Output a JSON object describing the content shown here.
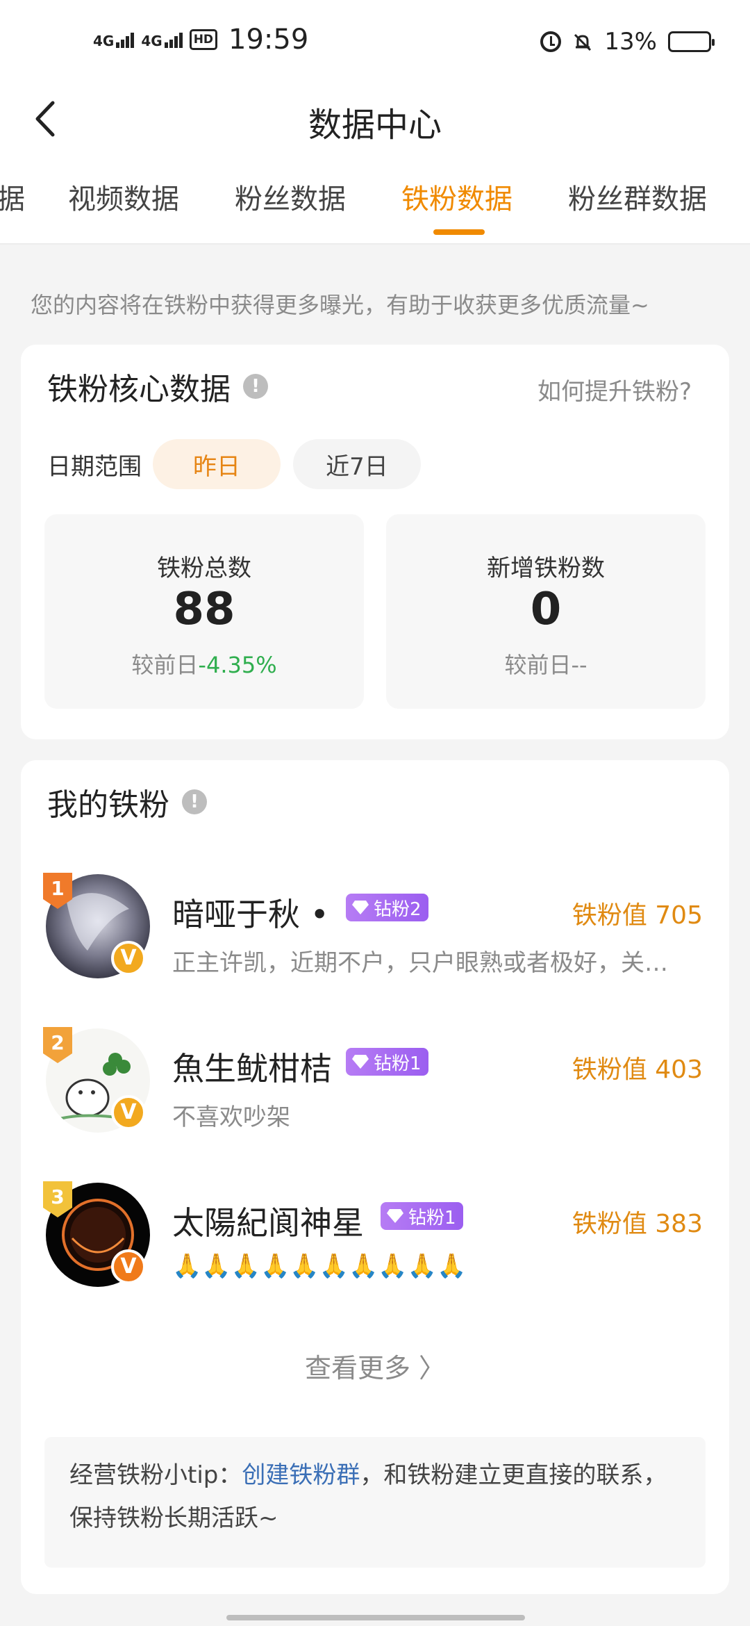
{
  "status_bar": {
    "network1": "4G",
    "network2": "4G",
    "hd": "HD",
    "time": "19:59",
    "battery_text": "13%",
    "battery_level": 0.13,
    "icons": [
      "alarm-icon",
      "bell-off-icon",
      "battery-icon"
    ]
  },
  "nav": {
    "title": "数据中心",
    "back_icon": "chevron-left-icon"
  },
  "tabs": [
    {
      "label": "据"
    },
    {
      "label": "视频数据"
    },
    {
      "label": "粉丝数据"
    },
    {
      "label": "铁粉数据",
      "active": true
    },
    {
      "label": "粉丝群数据"
    }
  ],
  "notice": "您的内容将在铁粉中获得更多曝光，有助于收获更多优质流量~",
  "core": {
    "title": "铁粉核心数据",
    "how_link": "如何提升铁粉?",
    "date_label": "日期范围",
    "chips": [
      "昨日",
      "近7日"
    ],
    "stats": [
      {
        "label": "铁粉总数",
        "value": "88",
        "cmp_prefix": "较前日",
        "cmp_value": "-4.35%"
      },
      {
        "label": "新增铁粉数",
        "value": "0",
        "cmp_prefix": "较前日",
        "cmp_value": "--"
      }
    ]
  },
  "fans": {
    "title": "我的铁粉",
    "items": [
      {
        "rank": "1",
        "name": "暗哑于秋 •",
        "badge": "钻粉2",
        "score": "铁粉值 705",
        "desc": "正主许凯，近期不户，只户眼熟或者极好，关…",
        "rank_color": "#f07a2a",
        "v_color": "#f2a91f"
      },
      {
        "rank": "2",
        "name": "魚生鱿柑桔",
        "badge": "钻粉1",
        "score": "铁粉值 403",
        "desc": "不喜欢吵架",
        "rank_color": "#f2a23a",
        "v_color": "#f2a91f"
      },
      {
        "rank": "3",
        "name": "太陽紀阆神星",
        "badge": "钻粉1",
        "score": "铁粉值 383",
        "desc": "🙏🙏🙏🙏🙏🙏🙏🙏🙏🙏",
        "rank_color": "#f2c23a",
        "v_color": "#f07a1a"
      }
    ],
    "more": "查看更多 〉",
    "tip_prefix": "经营铁粉小tip：",
    "tip_link": "创建铁粉群",
    "tip_suffix": "，和铁粉建立更直接的联系，保持铁粉长期活跃~"
  },
  "colors": {
    "accent": "#f08a00",
    "down": "#2fae4e",
    "link": "#3b6fb6",
    "badge": "#a66af2"
  }
}
